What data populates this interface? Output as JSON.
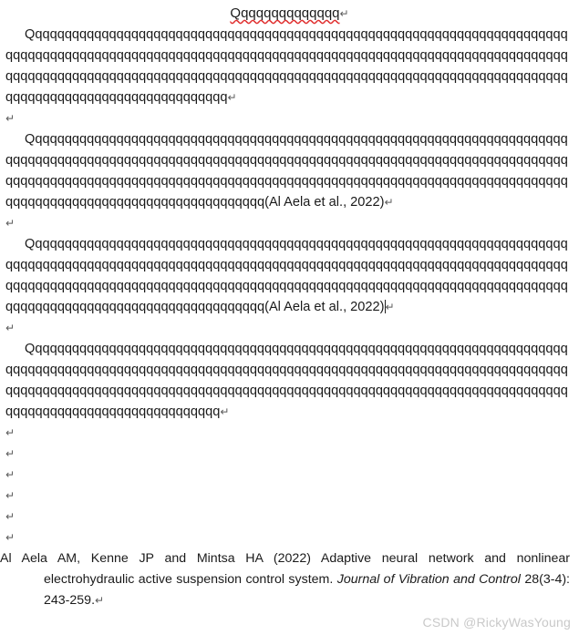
{
  "document": {
    "title": {
      "text": "Qqqqqqqqqqqqqq",
      "return_mark": "↵",
      "spellcheck_underline_color": "#e03030"
    },
    "paragraphs": [
      {
        "name": "paragraph-1",
        "text": "Qqqqqqqqqqqqqqqqqqqqqqqqqqqqqqqqqqqqqqqqqqqqqqqqqqqqqqqqqqqqqqqqqqqqqqqqqqqqqqqqqqqqqqqqqqqqqqqqqqqqqqqqqqqqqqqqqqqqqqqqqqqqqqqqqqqqqqqqqqqqqqqqqqqqqqqqqqqqqqqqqqqqqqqqqqqqqqqqqqqqqqqqqqqqqqqqqqqqqqqqqqqqqqqqqqqqqqqqqqqqqqqqqqqqqqqqqqqqqqqqqqqqqqqqqqqqqqq",
        "citation": "",
        "return_mark": "↵"
      },
      {
        "name": "paragraph-2",
        "text": "Qqqqqqqqqqqqqqqqqqqqqqqqqqqqqqqqqqqqqqqqqqqqqqqqqqqqqqqqqqqqqqqqqqqqqqqqqqqqqqqqqqqqqqqqqqqqqqqqqqqqqqqqqqqqqqqqqqqqqqqqqqqqqqqqqqqqqqqqqqqqqqqqqqqqqqqqqqqqqqqqqqqqqqqqqqqqqqqqqqqqqqqqqqqqqqqqqqqqqqqqqqqqqqqqqqqqqqqqqqqqqqqqqqqqqqqqqqqqqqqqqqqqqqqqqqqqqqqqqqqq",
        "citation": "(Al Aela et al., 2022)",
        "return_mark": "↵"
      },
      {
        "name": "paragraph-3",
        "text": "Qqqqqqqqqqqqqqqqqqqqqqqqqqqqqqqqqqqqqqqqqqqqqqqqqqqqqqqqqqqqqqqqqqqqqqqqqqqqqqqqqqqqqqqqqqqqqqqqqqqqqqqqqqqqqqqqqqqqqqqqqqqqqqqqqqqqqqqqqqqqqqqqqqqqqqqqqqqqqqqqqqqqqqqqqqqqqqqqqqqqqqqqqqqqqqqqqqqqqqqqqqqqqqqqqqqqqqqqqqqqqqqqqqqqqqqqqqqqqqqqqqqqqqqqqqqqqqqqqqqq",
        "citation": "(Al Aela et al., 2022)",
        "return_mark": "↵",
        "has_caret": true
      },
      {
        "name": "paragraph-4",
        "text": "Qqqqqqqqqqqqqqqqqqqqqqqqqqqqqqqqqqqqqqqqqqqqqqqqqqqqqqqqqqqqqqqqqqqqqqqqqqqqqqqqqqqqqqqqqqqqqqqqqqqqqqqqqqqqqqqqqqqqqqqqqqqqqqqqqqqqqqqqqqqqqqqqqqqqqqqqqqqqqqqqqqqqqqqqqqqqqqqqqqqqqqqqqqqqqqqqqqqqqqqqqqqqqqqqqqqqqqqqqqqqqqqqqqqqqqqqqqqqqqqqqqqqqqqqqqqqqq",
        "citation": "",
        "return_mark": "↵"
      }
    ],
    "empty_lines_between_paragraphs": [
      {
        "name": "empty-line-after-p1",
        "mark": "↵"
      },
      {
        "name": "empty-line-after-p2",
        "mark": "↵"
      },
      {
        "name": "empty-line-after-p3",
        "mark": "↵"
      }
    ],
    "empty_lines_before_reference": [
      {
        "name": "empty-line-1",
        "mark": "↵"
      },
      {
        "name": "empty-line-2",
        "mark": "↵"
      },
      {
        "name": "empty-line-3",
        "mark": "↵"
      },
      {
        "name": "empty-line-4",
        "mark": "↵"
      },
      {
        "name": "empty-line-5",
        "mark": "↵"
      },
      {
        "name": "empty-line-6",
        "mark": "↵"
      }
    ],
    "reference": {
      "authors_and_year": "Al Aela AM, Kenne JP and Mintsa HA (2022) ",
      "article_title": "Adaptive neural network and nonlinear electrohydraulic active suspension control system. ",
      "journal": "Journal of Vibration and Control",
      "volume_issue_pages": " 28(3-4): 243-259.",
      "return_mark": "↵"
    }
  },
  "watermark": {
    "text": "CSDN @RickyWasYoung",
    "color": "#c9c9c9"
  }
}
